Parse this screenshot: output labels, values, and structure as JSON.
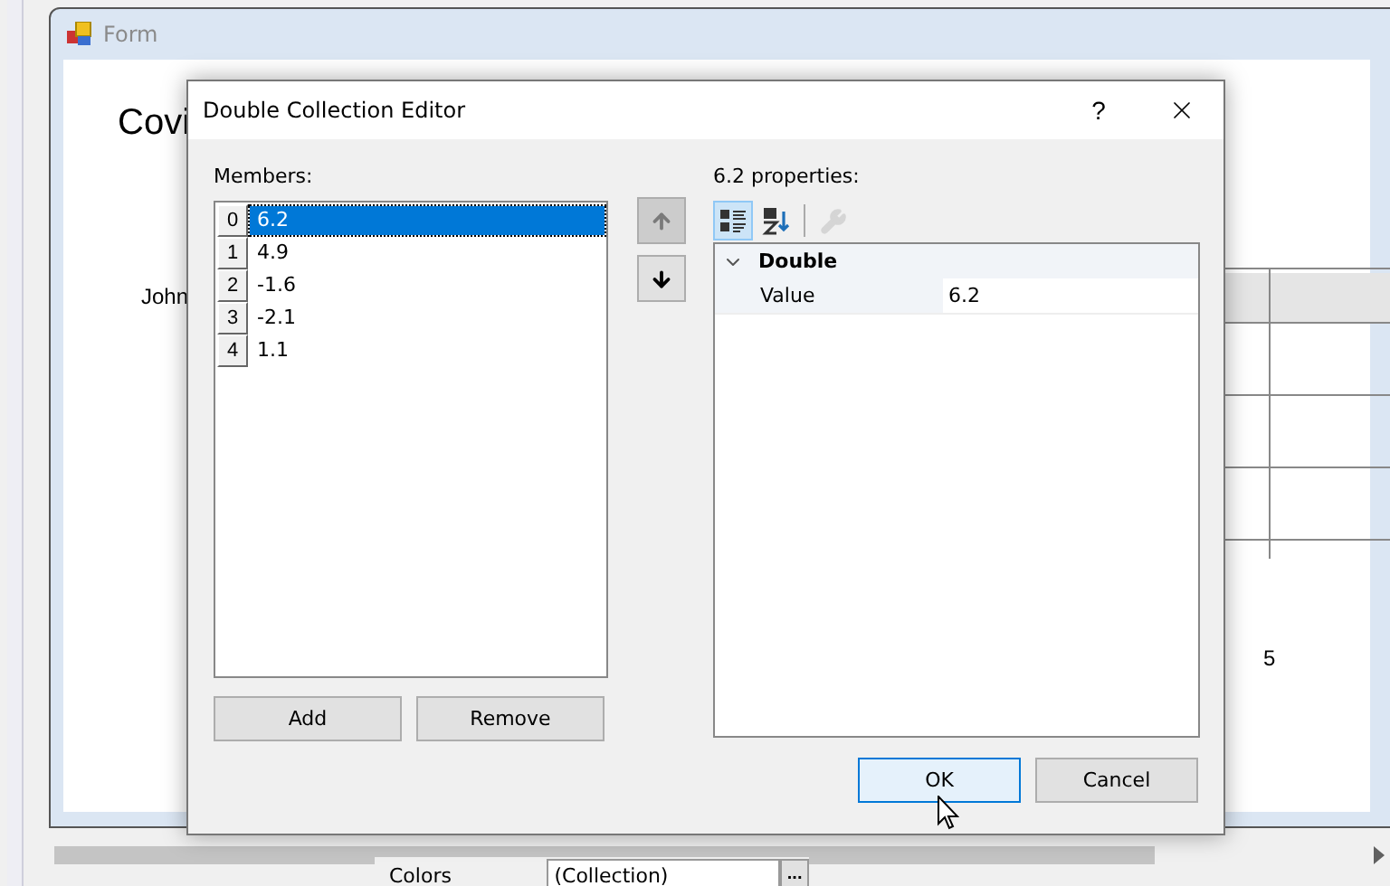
{
  "form": {
    "title": "Form",
    "heading": "Covi",
    "name_label": "John",
    "axis_label": "5"
  },
  "property_grid": {
    "rows": [
      {
        "label": "Colors",
        "value": "(Collection)",
        "button": "..."
      }
    ]
  },
  "dialog": {
    "title": "Double Collection Editor",
    "help": "?",
    "members_label": "Members:",
    "members": [
      {
        "index": "0",
        "value": "6.2",
        "selected": true
      },
      {
        "index": "1",
        "value": "4.9",
        "selected": false
      },
      {
        "index": "2",
        "value": "-1.6",
        "selected": false
      },
      {
        "index": "3",
        "value": "-2.1",
        "selected": false
      },
      {
        "index": "4",
        "value": "1.1",
        "selected": false
      }
    ],
    "move_buttons": [
      {
        "kind": "up",
        "disabled": true
      },
      {
        "kind": "down",
        "disabled": false
      }
    ],
    "properties_label": "6.2 properties:",
    "toolbar": [
      {
        "kind": "categorized",
        "selected": true,
        "disabled": false
      },
      {
        "kind": "alphabetical",
        "selected": false,
        "disabled": false
      },
      {
        "kind": "pages",
        "selected": false,
        "disabled": true
      }
    ],
    "grid": {
      "category": "Double",
      "expanded": true,
      "rows": [
        {
          "name": "Value",
          "value": "6.2"
        }
      ]
    },
    "list_buttons": [
      {
        "label": "Add"
      },
      {
        "label": "Remove"
      }
    ],
    "footer_buttons": [
      {
        "label": "OK",
        "focused": true
      },
      {
        "label": "Cancel",
        "focused": false
      }
    ]
  }
}
